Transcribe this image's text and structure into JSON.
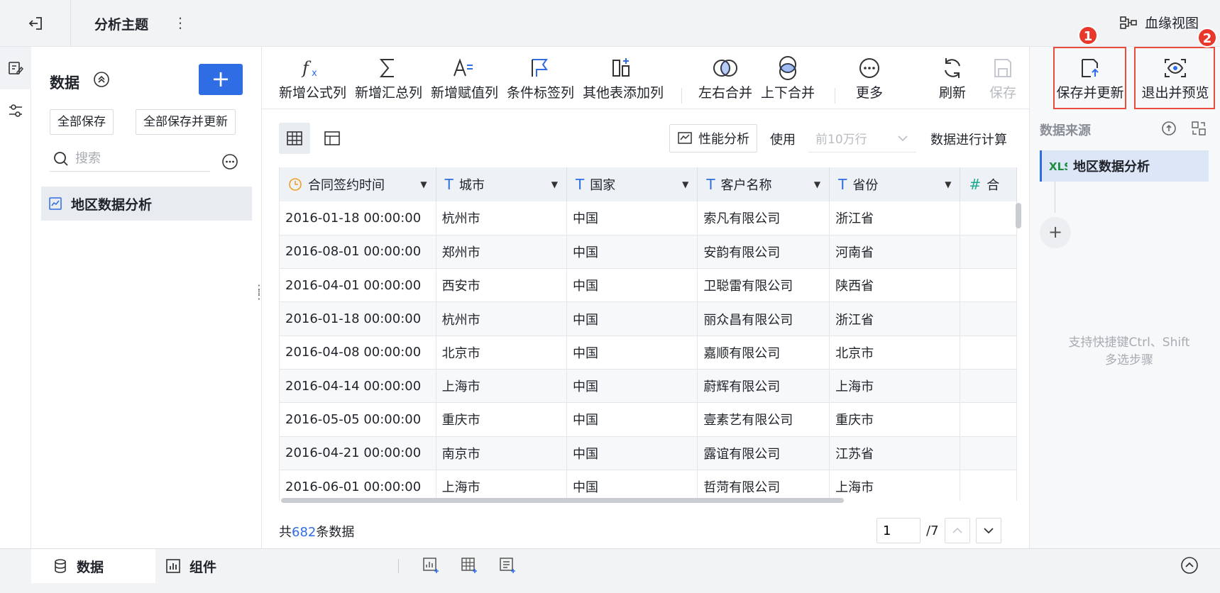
{
  "topbar": {
    "title": "分析主题",
    "lineage_label": "血缘视图"
  },
  "sidebar": {
    "title": "数据",
    "save_all": "全部保存",
    "save_all_update": "全部保存并更新",
    "search_placeholder": "搜索",
    "datasets": [
      {
        "label": "地区数据分析"
      }
    ]
  },
  "toolbar": {
    "tools": [
      {
        "label": "新增公式列"
      },
      {
        "label": "新增汇总列"
      },
      {
        "label": "新增赋值列"
      },
      {
        "label": "条件标签列"
      },
      {
        "label": "其他表添加列"
      },
      {
        "label": "左右合并"
      },
      {
        "label": "上下合并"
      },
      {
        "label": "更多"
      },
      {
        "label": "刷新"
      },
      {
        "label": "保存"
      },
      {
        "label": "保存并更新"
      },
      {
        "label": "退出并预览"
      }
    ]
  },
  "viewbar": {
    "perf_label": "性能分析",
    "use_label": "使用",
    "row_placeholder": "前10万行",
    "calc_label": "数据进行计算"
  },
  "table": {
    "columns": [
      {
        "name": "合同签约时间",
        "type": "date"
      },
      {
        "name": "城市",
        "type": "text"
      },
      {
        "name": "国家",
        "type": "text"
      },
      {
        "name": "客户名称",
        "type": "text"
      },
      {
        "name": "省份",
        "type": "text"
      },
      {
        "name": "合",
        "type": "number"
      }
    ],
    "rows": [
      [
        "2016-01-18 00:00:00",
        "杭州市",
        "中国",
        "索凡有限公司",
        "浙江省",
        ""
      ],
      [
        "2016-08-01 00:00:00",
        "郑州市",
        "中国",
        "安韵有限公司",
        "河南省",
        ""
      ],
      [
        "2016-04-01 00:00:00",
        "西安市",
        "中国",
        "卫聪雷有限公司",
        "陕西省",
        ""
      ],
      [
        "2016-01-18 00:00:00",
        "杭州市",
        "中国",
        "丽众昌有限公司",
        "浙江省",
        ""
      ],
      [
        "2016-04-08 00:00:00",
        "北京市",
        "中国",
        "嘉顺有限公司",
        "北京市",
        ""
      ],
      [
        "2016-04-14 00:00:00",
        "上海市",
        "中国",
        "蔚辉有限公司",
        "上海市",
        ""
      ],
      [
        "2016-05-05 00:00:00",
        "重庆市",
        "中国",
        "壹素艺有限公司",
        "重庆市",
        ""
      ],
      [
        "2016-04-21 00:00:00",
        "南京市",
        "中国",
        "露谊有限公司",
        "江苏省",
        ""
      ],
      [
        "2016-06-01 00:00:00",
        "上海市",
        "中国",
        "哲菏有限公司",
        "上海市",
        ""
      ]
    ]
  },
  "footer": {
    "count_prefix": "共",
    "count": "682",
    "count_suffix": "条数据",
    "page_value": "1",
    "page_total": "/7"
  },
  "rpanel": {
    "title": "数据来源",
    "step_label": "地区数据分析",
    "hint_line1": "支持快捷键Ctrl、Shift",
    "hint_line2": "多选步骤"
  },
  "bottombar": {
    "tab_data": "数据",
    "tab_component": "组件"
  },
  "annotations": {
    "badge1": "1",
    "badge2": "2"
  },
  "colors": {
    "accent": "#2f6de5",
    "highlight": "#e84c3d"
  }
}
